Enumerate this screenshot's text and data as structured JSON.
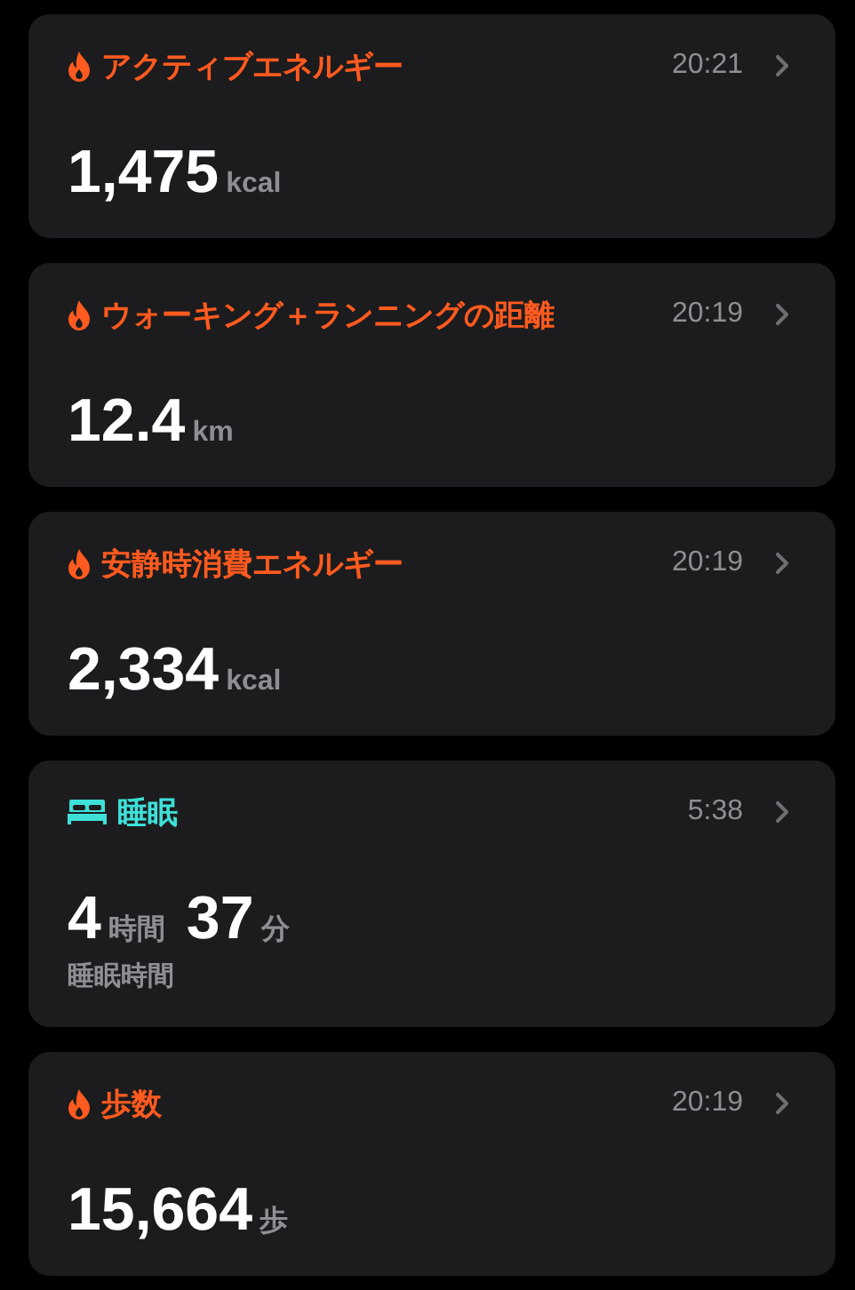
{
  "cards": [
    {
      "kind": "flame",
      "color": "#ff5a1f",
      "title": "アクティブエネルギー",
      "time": "20:21",
      "values": [
        {
          "number": "1,475",
          "unit": "kcal"
        }
      ]
    },
    {
      "kind": "flame",
      "color": "#ff5a1f",
      "title": "ウォーキング＋ランニングの距離",
      "time": "20:19",
      "values": [
        {
          "number": "12.4",
          "unit": "km"
        }
      ]
    },
    {
      "kind": "flame",
      "color": "#ff5a1f",
      "title": "安静時消費エネルギー",
      "time": "20:19",
      "values": [
        {
          "number": "2,334",
          "unit": "kcal"
        }
      ]
    },
    {
      "kind": "bed",
      "color": "#3ee0d8",
      "title": "睡眠",
      "time": "5:38",
      "values": [
        {
          "number": "4",
          "unit": "時間"
        },
        {
          "number": "37",
          "unit": "分"
        }
      ],
      "caption": "睡眠時間"
    },
    {
      "kind": "flame",
      "color": "#ff5a1f",
      "title": "歩数",
      "time": "20:19",
      "values": [
        {
          "number": "15,664",
          "unit": "歩"
        }
      ]
    }
  ]
}
